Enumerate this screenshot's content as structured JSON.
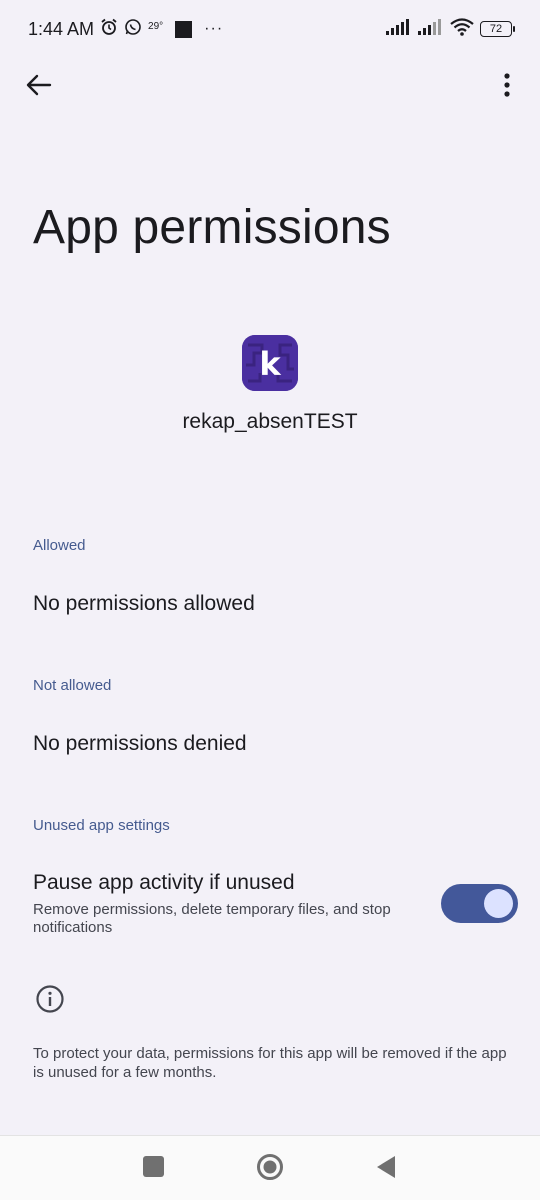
{
  "status_bar": {
    "time": "1:44 AM",
    "temperature": "29°",
    "more_dots": "···",
    "battery": "72"
  },
  "page": {
    "title": "App permissions",
    "app_name": "rekap_absenTEST",
    "app_icon_letter": "k"
  },
  "sections": {
    "allowed": {
      "header": "Allowed",
      "item": "No permissions allowed"
    },
    "not_allowed": {
      "header": "Not allowed",
      "item": "No permissions denied"
    },
    "unused": {
      "header": "Unused app settings",
      "pause_title": "Pause app activity if unused",
      "pause_summary": "Remove permissions, delete temporary files, and stop notifications",
      "pause_enabled": true
    }
  },
  "footer": {
    "text": "To protect your data, permissions for this app will be removed if the app is unused for a few months."
  },
  "colors": {
    "background": "#f3f1f8",
    "accent": "#43589a",
    "section_header": "#455b8f",
    "app_icon_bg": "#4a2fa0"
  }
}
